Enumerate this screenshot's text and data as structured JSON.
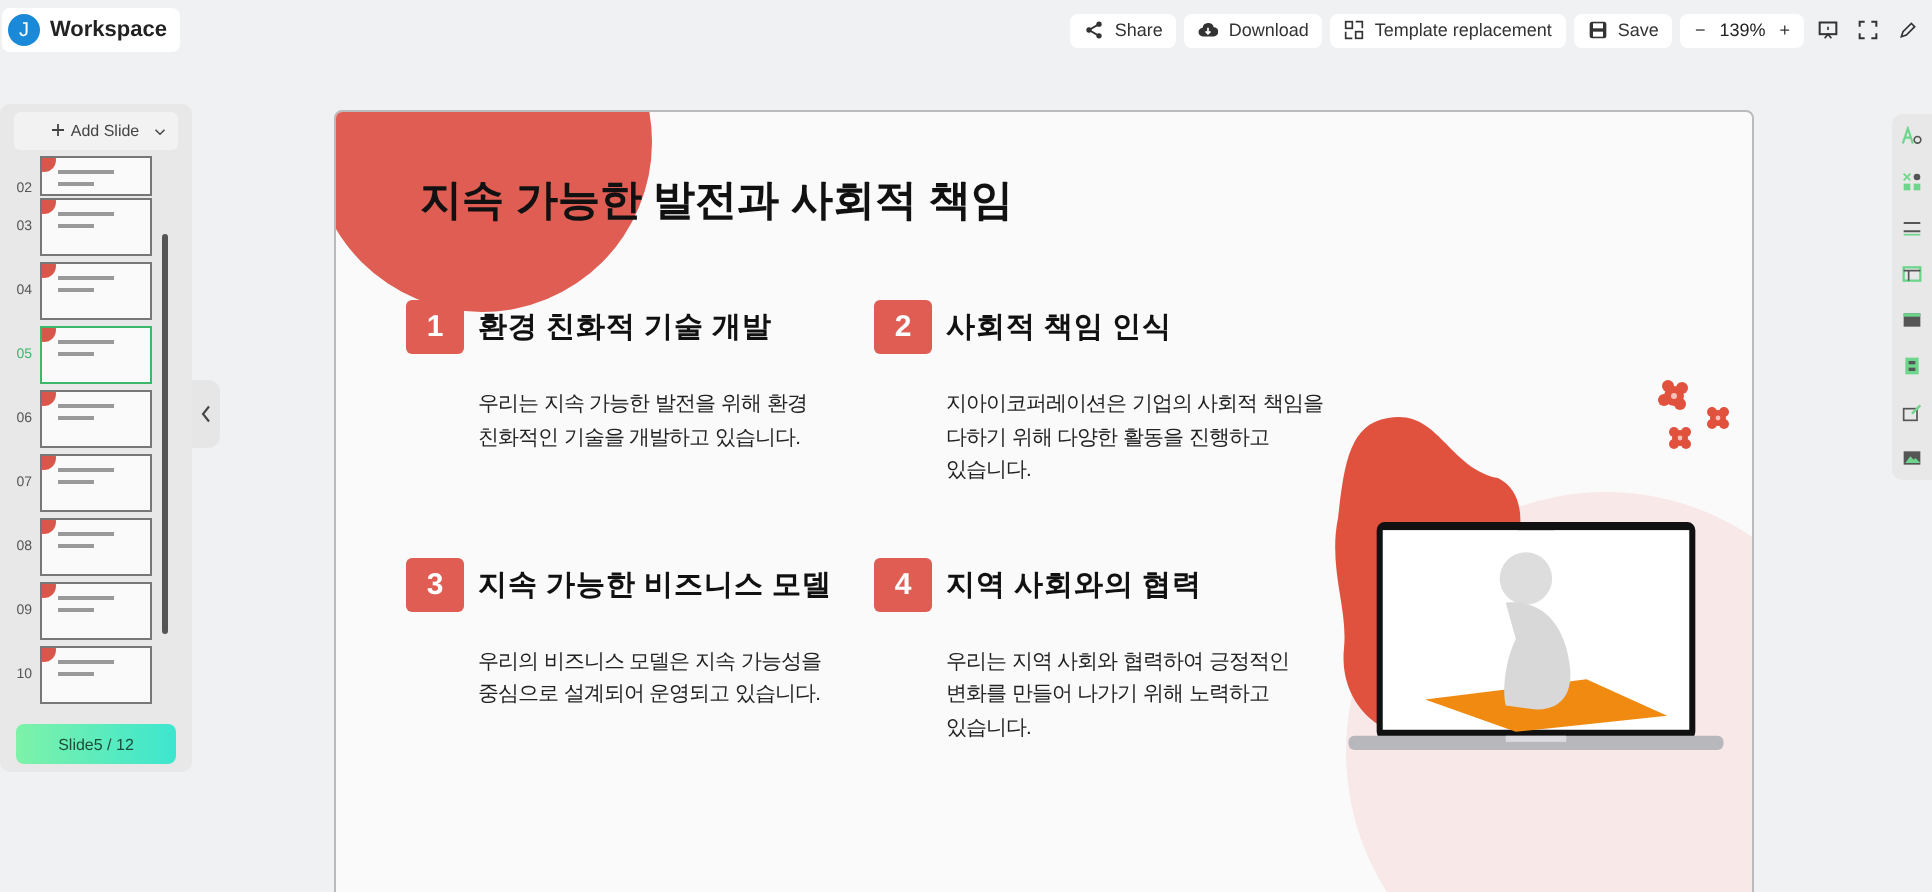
{
  "app": {
    "avatar": "J",
    "title": "Workspace"
  },
  "toolbar": {
    "buttons": [
      {
        "kind": "share",
        "label": "Share"
      },
      {
        "kind": "download",
        "label": "Download"
      },
      {
        "kind": "template",
        "label": "Template replacement"
      },
      {
        "kind": "save",
        "label": "Save"
      }
    ],
    "zoom_out": "−",
    "zoom": "139%",
    "zoom_in": "+"
  },
  "sidebar": {
    "add_label": "Add Slide",
    "slides": [
      {
        "number": "02",
        "selected": false
      },
      {
        "number": "03",
        "selected": false
      },
      {
        "number": "04",
        "selected": false
      },
      {
        "number": "05",
        "selected": true
      },
      {
        "number": "06",
        "selected": false
      },
      {
        "number": "07",
        "selected": false
      },
      {
        "number": "08",
        "selected": false
      },
      {
        "number": "09",
        "selected": false
      },
      {
        "number": "10",
        "selected": false
      }
    ],
    "counter": "Slide5 / 12"
  },
  "slide": {
    "title": "지속 가능한 발전과 사회적 책임",
    "items": [
      {
        "number": "1",
        "heading": "환경 친화적 기술 개발",
        "body": "우리는 지속 가능한 발전을 위해 환경 친화적인 기술을 개발하고 있습니다."
      },
      {
        "number": "2",
        "heading": "사회적 책임 인식",
        "body": "지아이코퍼레이션은 기업의 사회적 책임을 다하기 위해 다양한 활동을 진행하고 있습니다."
      },
      {
        "number": "3",
        "heading": "지속 가능한 비즈니스 모델",
        "body": "우리의 비즈니스 모델은 지속 가능성을 중심으로 설계되어 운영되고 있습니다."
      },
      {
        "number": "4",
        "heading": "지역 사회와의 협력",
        "body": "우리는 지역 사회와 협력하여 긍정적인 변화를 만들어 나가기 위해 노력하고 있습니다."
      }
    ]
  }
}
